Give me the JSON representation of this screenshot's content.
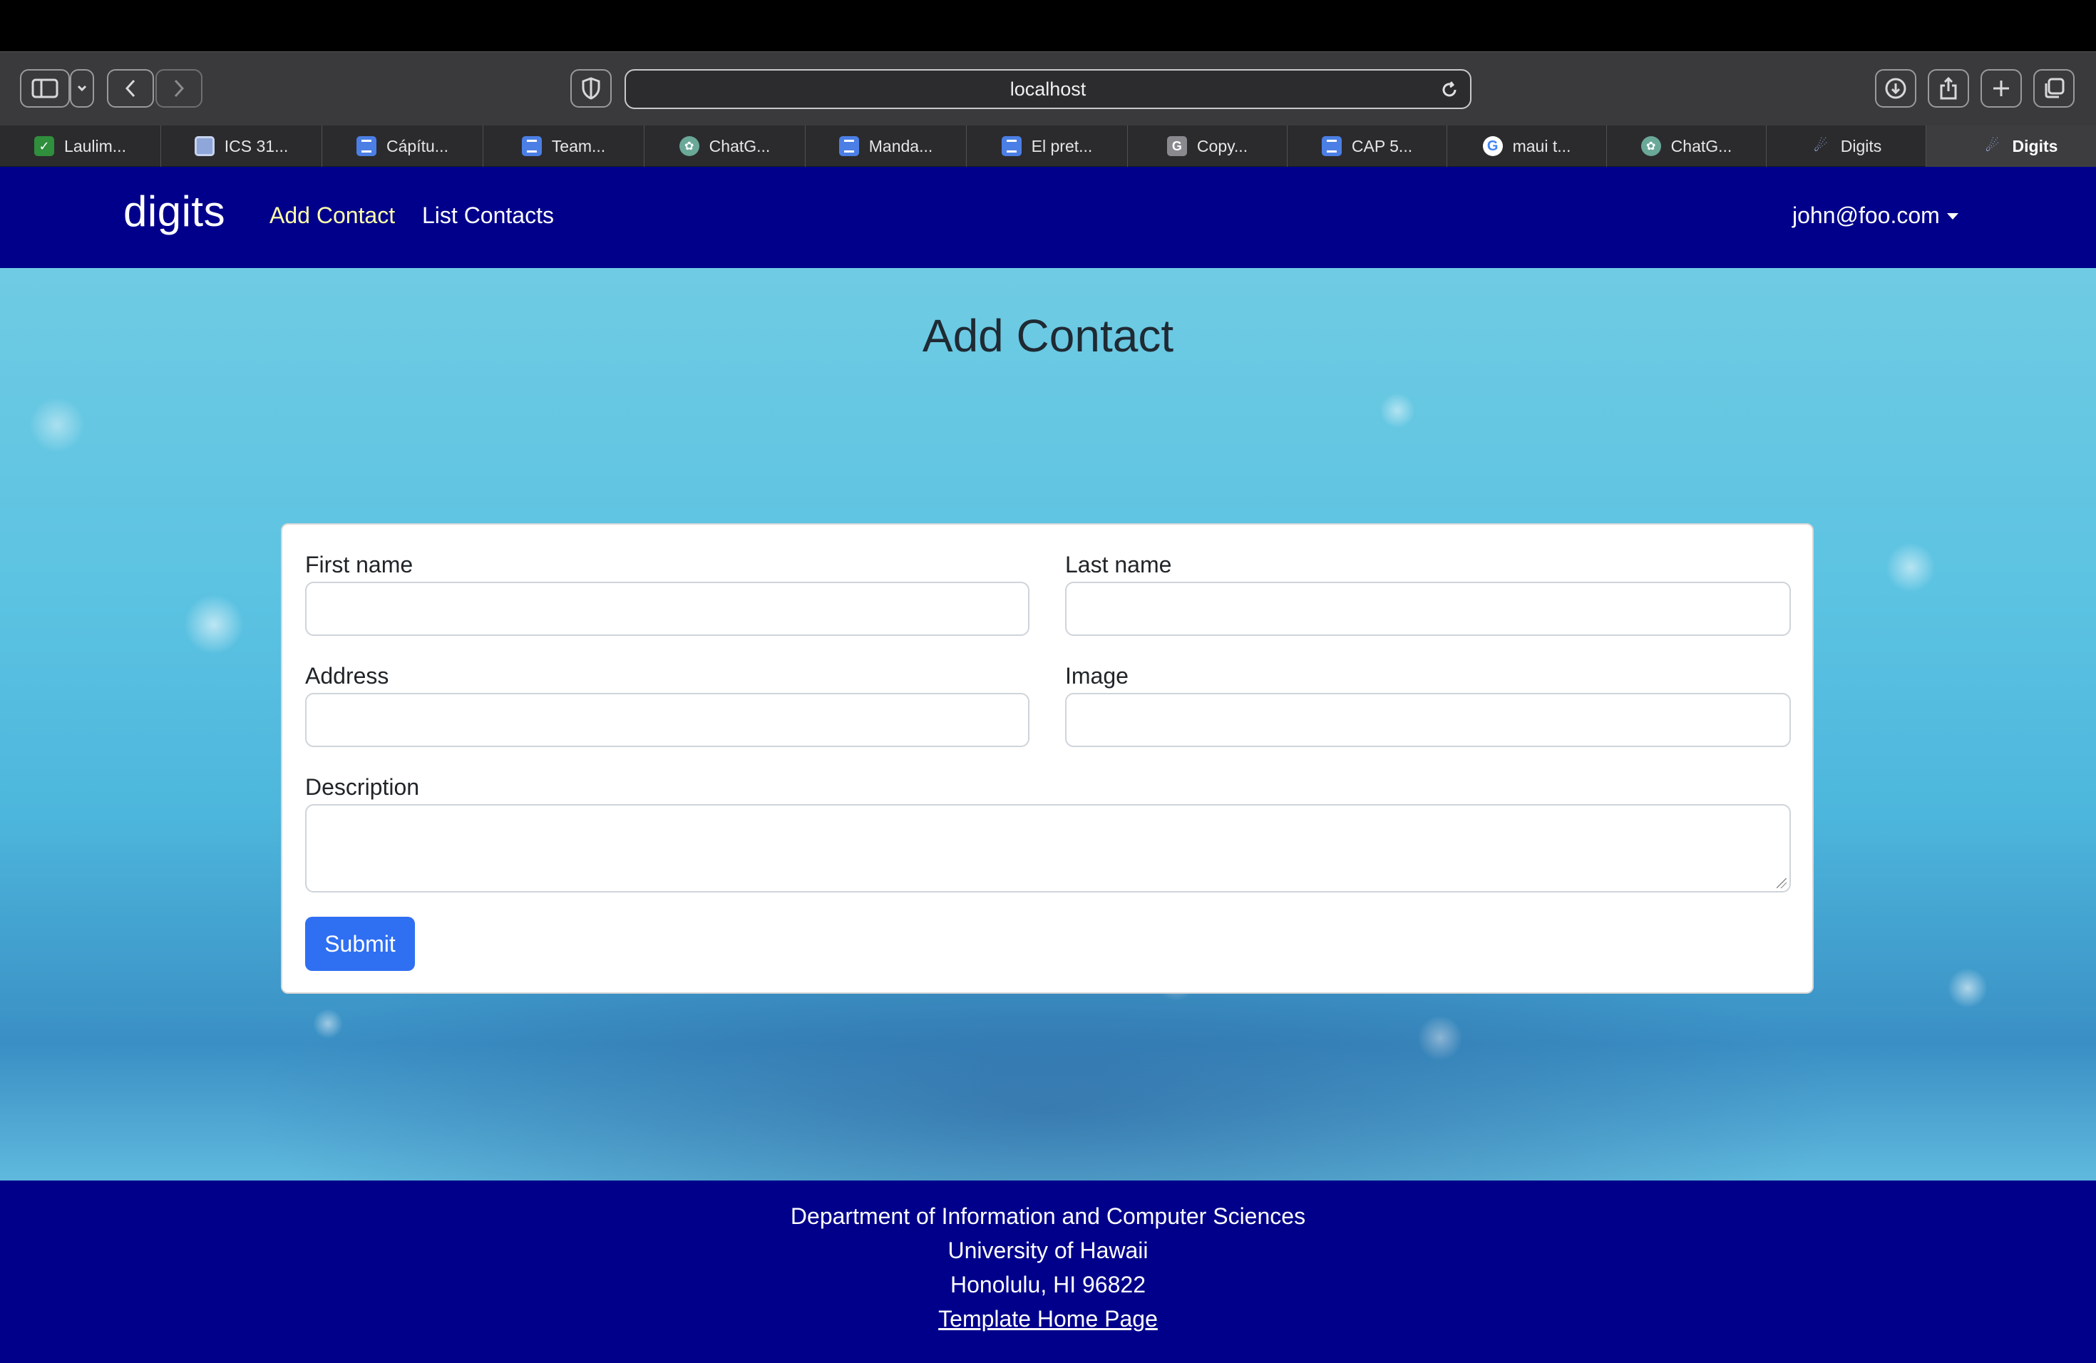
{
  "browser": {
    "url": "localhost",
    "tabs": [
      {
        "label": "Laulim...",
        "icon": "leaf-icon"
      },
      {
        "label": "ICS 31...",
        "icon": "course-icon"
      },
      {
        "label": "Cápítu...",
        "icon": "docs-icon"
      },
      {
        "label": "Team...",
        "icon": "docs-icon"
      },
      {
        "label": "ChatG...",
        "icon": "chatgpt-icon"
      },
      {
        "label": "Manda...",
        "icon": "docs-icon"
      },
      {
        "label": "El pret...",
        "icon": "docs-icon"
      },
      {
        "label": "Copy...",
        "icon": "g-icon"
      },
      {
        "label": "CAP 5...",
        "icon": "docs-icon"
      },
      {
        "label": "maui t...",
        "icon": "google-icon"
      },
      {
        "label": "ChatG...",
        "icon": "chatgpt-icon"
      },
      {
        "label": "Digits",
        "icon": "meteor-icon"
      },
      {
        "label": "Digits",
        "icon": "meteor-icon",
        "active": true
      }
    ]
  },
  "navbar": {
    "brand": "digits",
    "links": {
      "add_contact": "Add Contact",
      "list_contacts": "List Contacts"
    },
    "user": "john@foo.com"
  },
  "form": {
    "title": "Add Contact",
    "fields": {
      "first_name": {
        "label": "First name",
        "value": ""
      },
      "last_name": {
        "label": "Last name",
        "value": ""
      },
      "address": {
        "label": "Address",
        "value": ""
      },
      "image": {
        "label": "Image",
        "value": ""
      },
      "description": {
        "label": "Description",
        "value": ""
      }
    },
    "submit_label": "Submit"
  },
  "footer": {
    "line1": "Department of Information and Computer Sciences",
    "line2": "University of Hawaii",
    "line3": "Honolulu, HI 96822",
    "link": "Template Home Page"
  },
  "colors": {
    "navbar": "#00008b",
    "active_link": "#ffffaa",
    "submit": "#2f6ff2"
  }
}
